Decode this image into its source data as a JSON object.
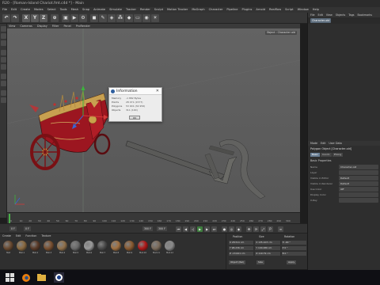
{
  "window": {
    "title": "R20 - [Roman-Island Chariot.fmt.c4d *] - Main"
  },
  "menubar": [
    "File",
    "Edit",
    "Create",
    "Modes",
    "Select",
    "Tools",
    "Mesh",
    "Snap",
    "Animate",
    "Simulate",
    "Tracker",
    "Render",
    "Sculpt",
    "Motion Tracker",
    "MoGraph",
    "Character",
    "Pipeline",
    "Plugins",
    "Arnold",
    "Realflow",
    "Script",
    "Window",
    "Help"
  ],
  "toolbar": {
    "btn_x": "X",
    "btn_y": "Y",
    "btn_z": "Z"
  },
  "viewport": {
    "menu": [
      "View",
      "Cameras",
      "Display",
      "Filter",
      "Panel",
      "ProRender"
    ],
    "label": "Object : Character old"
  },
  "dialog": {
    "title": "Information",
    "rows": [
      {
        "key": "Memory",
        "value": "-1 882 Bytes"
      },
      {
        "key": "Points",
        "value": "28 471 (1577)"
      },
      {
        "key": "Polygons",
        "value": "53 901 (34 956)"
      },
      {
        "key": "Objects",
        "value": "311 (100)"
      }
    ],
    "ok_label": "OK"
  },
  "right_panel": {
    "menu": [
      "File",
      "Edit",
      "View",
      "Objects",
      "Tags",
      "Bookmarks"
    ],
    "object_name": "Character-old",
    "attr_menu": [
      "Mode",
      "Edit",
      "User Data"
    ],
    "attr_title": "Polygon Object [Character-old]",
    "tabs": [
      "Basic",
      "Coord.",
      "Phong"
    ],
    "section": "Basic Properties",
    "fields": [
      {
        "label": "Name",
        "value": "Character-old"
      },
      {
        "label": "Layer",
        "value": ""
      },
      {
        "label": "Visible in Editor",
        "value": "Default"
      },
      {
        "label": "Visible in Renderer",
        "value": "Default"
      },
      {
        "label": "Use Color",
        "value": "Off"
      },
      {
        "label": "Display Color",
        "value": ""
      },
      {
        "label": "X-Ray",
        "value": ""
      }
    ]
  },
  "timeline": {
    "ticks": [
      "0",
      "10",
      "20",
      "30",
      "40",
      "50",
      "60",
      "70",
      "80",
      "90",
      "100",
      "110",
      "120",
      "130",
      "140",
      "150",
      "160",
      "170",
      "180",
      "190",
      "200",
      "210",
      "220",
      "230",
      "240",
      "250",
      "260",
      "270",
      "280",
      "290",
      "300"
    ],
    "end_label": "0 F"
  },
  "transport": {
    "start": "0 F",
    "current": "0 F",
    "end": "300 F",
    "end2": "300 F"
  },
  "materials": {
    "menu": [
      "Create",
      "Edit",
      "Function",
      "Texture"
    ],
    "items": [
      {
        "label": "Mat",
        "color": "#6a4a30"
      },
      {
        "label": "Mat.1",
        "color": "#8a6a40"
      },
      {
        "label": "Mat.2",
        "color": "#5a3a28"
      },
      {
        "label": "Mat.3",
        "color": "#7a5030"
      },
      {
        "label": "Mat.4",
        "color": "#90704a"
      },
      {
        "label": "Mat.5",
        "color": "#6a6a6a"
      },
      {
        "label": "Mat.6",
        "color": "#9a9a9a"
      },
      {
        "label": "Mat.7",
        "color": "#4a4a4a"
      },
      {
        "label": "Mat.8",
        "color": "#a07040"
      },
      {
        "label": "Mat.9",
        "color": "#8a5a30"
      },
      {
        "label": "Mat.10",
        "color": "#b01818"
      },
      {
        "label": "Mat.11",
        "color": "#7a6a5a"
      },
      {
        "label": "Mat.12",
        "color": "#8a8a8a"
      }
    ]
  },
  "coords": {
    "headers": [
      "Position",
      "Size",
      "Rotation"
    ],
    "rows": [
      {
        "a": "X  28.511 cm",
        "b": "X  135.103 cm",
        "c": "H  -90 °"
      },
      {
        "a": "Y  98.236 cm",
        "b": "Y  100.286 cm",
        "c": "P  0 °"
      },
      {
        "a": "Z  -13.621 cm",
        "b": "Z  119.79 cm",
        "c": "B  0 °"
      }
    ],
    "mode_object": "Object (Rel)",
    "mode_size": "Size",
    "apply": "Apply"
  }
}
